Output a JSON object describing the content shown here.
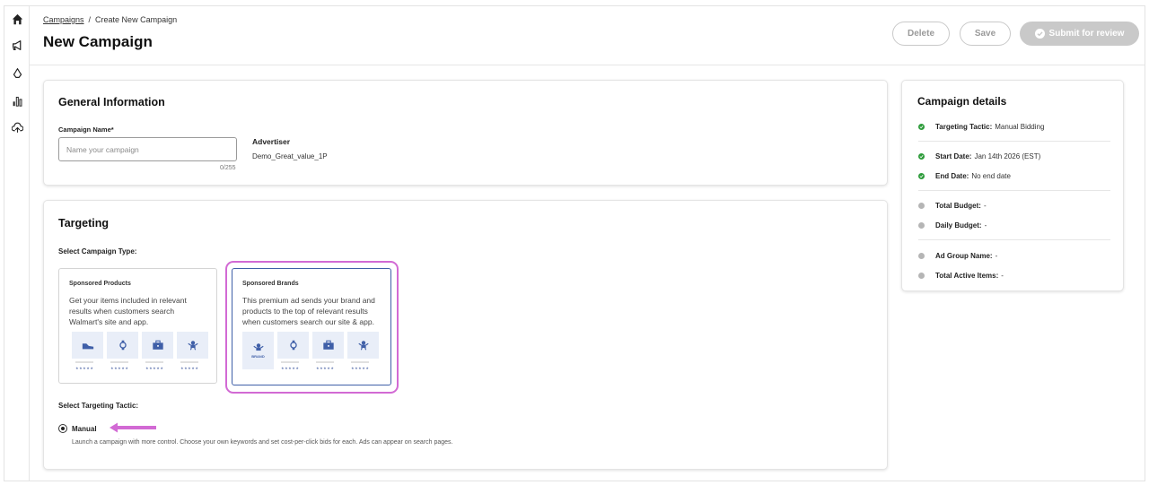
{
  "sidebar": {
    "items": [
      {
        "icon": "home-icon"
      },
      {
        "icon": "megaphone-icon"
      },
      {
        "icon": "recycle-icon"
      },
      {
        "icon": "bar-chart-icon"
      },
      {
        "icon": "cloud-upload-icon"
      }
    ]
  },
  "header": {
    "breadcrumb_link": "Campaigns",
    "breadcrumb_sep": "/",
    "breadcrumb_current": "Create New Campaign",
    "title": "New Campaign",
    "delete_label": "Delete",
    "save_label": "Save",
    "submit_label": "Submit for review"
  },
  "general": {
    "title": "General Information",
    "name_label": "Campaign Name*",
    "name_placeholder": "Name your campaign",
    "name_counter": "0/255",
    "advertiser_label": "Advertiser",
    "advertiser_value": "Demo_Great_value_1P"
  },
  "targeting": {
    "title": "Targeting",
    "type_label": "Select Campaign Type:",
    "types": [
      {
        "title": "Sponsored Products",
        "desc": "Get your items included in relevant results when customers search Walmart's site and app.",
        "selected": false
      },
      {
        "title": "Sponsored Brands",
        "desc": "This premium ad sends your brand and products to the top of relevant results when customers search our site & app.",
        "selected": true,
        "brand_text": "BRAND"
      }
    ],
    "stars": "★★★★★",
    "tactic_label": "Select Targeting Tactic:",
    "tactic_option": "Manual",
    "tactic_desc": "Launch a campaign with more control. Choose your own keywords and set cost-per-click bids for each. Ads can appear on search pages."
  },
  "details": {
    "title": "Campaign details",
    "rows": [
      {
        "label": "Targeting Tactic:",
        "value": "Manual Bidding",
        "status": "complete"
      },
      {
        "label": "Start Date:",
        "value": "Jan 14th 2026 (EST)",
        "status": "complete"
      },
      {
        "label": "End Date:",
        "value": "No end date",
        "status": "complete"
      },
      {
        "label": "Total Budget:",
        "value": "-",
        "status": "pending"
      },
      {
        "label": "Daily Budget:",
        "value": "-",
        "status": "pending"
      },
      {
        "label": "Ad Group Name:",
        "value": "-",
        "status": "pending"
      },
      {
        "label": "Total Active Items:",
        "value": "-",
        "status": "pending"
      }
    ]
  },
  "colors": {
    "accent_blue": "#3f5fa8",
    "highlight_pink": "#d26ad4",
    "status_green": "#2e9c3b",
    "status_gray": "#b5b5b5"
  }
}
